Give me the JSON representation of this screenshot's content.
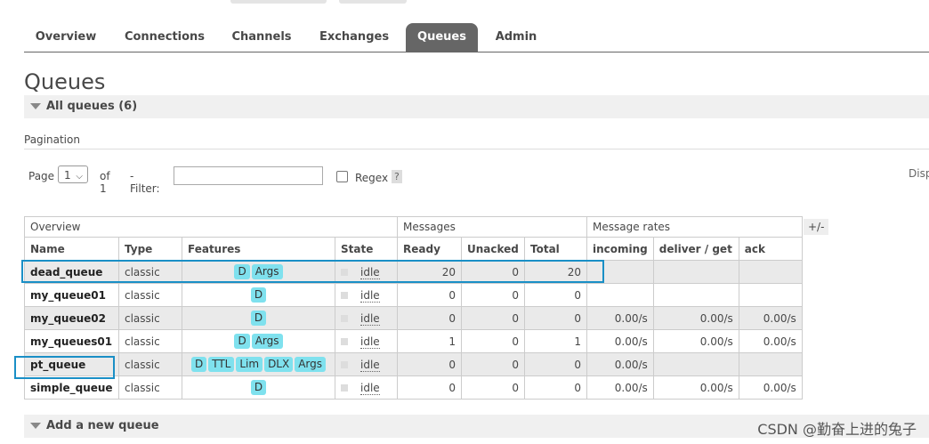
{
  "tabs": [
    {
      "label": "Overview",
      "active": false
    },
    {
      "label": "Connections",
      "active": false
    },
    {
      "label": "Channels",
      "active": false
    },
    {
      "label": "Exchanges",
      "active": false
    },
    {
      "label": "Queues",
      "active": true
    },
    {
      "label": "Admin",
      "active": false
    }
  ],
  "page_title": "Queues",
  "all_queues_label": "All queues (6)",
  "pagination": {
    "label": "Pagination",
    "page_label": "Page",
    "page_value": "1",
    "of_label": "of 1",
    "filter_label": "- Filter:",
    "filter_value": "",
    "regex_label": "Regex",
    "help_label": "?",
    "display_cut": "Disp"
  },
  "table": {
    "groups": [
      "Overview",
      "Messages",
      "Message rates"
    ],
    "plusminus": "+/-",
    "headers": [
      "Name",
      "Type",
      "Features",
      "State",
      "Ready",
      "Unacked",
      "Total",
      "incoming",
      "deliver / get",
      "ack"
    ],
    "rows": [
      {
        "name": "dead_queue",
        "type": "classic",
        "features": [
          "D",
          "Args"
        ],
        "state": "idle",
        "ready": "20",
        "unacked": "0",
        "total": "20",
        "incoming": "",
        "deliver": "",
        "ack": ""
      },
      {
        "name": "my_queue01",
        "type": "classic",
        "features": [
          "D"
        ],
        "state": "idle",
        "ready": "0",
        "unacked": "0",
        "total": "0",
        "incoming": "",
        "deliver": "",
        "ack": ""
      },
      {
        "name": "my_queue02",
        "type": "classic",
        "features": [
          "D"
        ],
        "state": "idle",
        "ready": "0",
        "unacked": "0",
        "total": "0",
        "incoming": "0.00/s",
        "deliver": "0.00/s",
        "ack": "0.00/s"
      },
      {
        "name": "my_queues01",
        "type": "classic",
        "features": [
          "D",
          "Args"
        ],
        "state": "idle",
        "ready": "1",
        "unacked": "0",
        "total": "1",
        "incoming": "0.00/s",
        "deliver": "0.00/s",
        "ack": "0.00/s"
      },
      {
        "name": "pt_queue",
        "type": "classic",
        "features": [
          "D",
          "TTL",
          "Lim",
          "DLX",
          "Args"
        ],
        "state": "idle",
        "ready": "0",
        "unacked": "0",
        "total": "0",
        "incoming": "0.00/s",
        "deliver": "",
        "ack": ""
      },
      {
        "name": "simple_queue",
        "type": "classic",
        "features": [
          "D"
        ],
        "state": "idle",
        "ready": "0",
        "unacked": "0",
        "total": "0",
        "incoming": "0.00/s",
        "deliver": "0.00/s",
        "ack": "0.00/s"
      }
    ]
  },
  "add_queue_label": "Add a new queue",
  "watermark": "CSDN @勤奋上进的兔子",
  "colors": {
    "badge": "#7fe1ee",
    "active_tab": "#666666",
    "highlight": "#1a8fc6"
  }
}
